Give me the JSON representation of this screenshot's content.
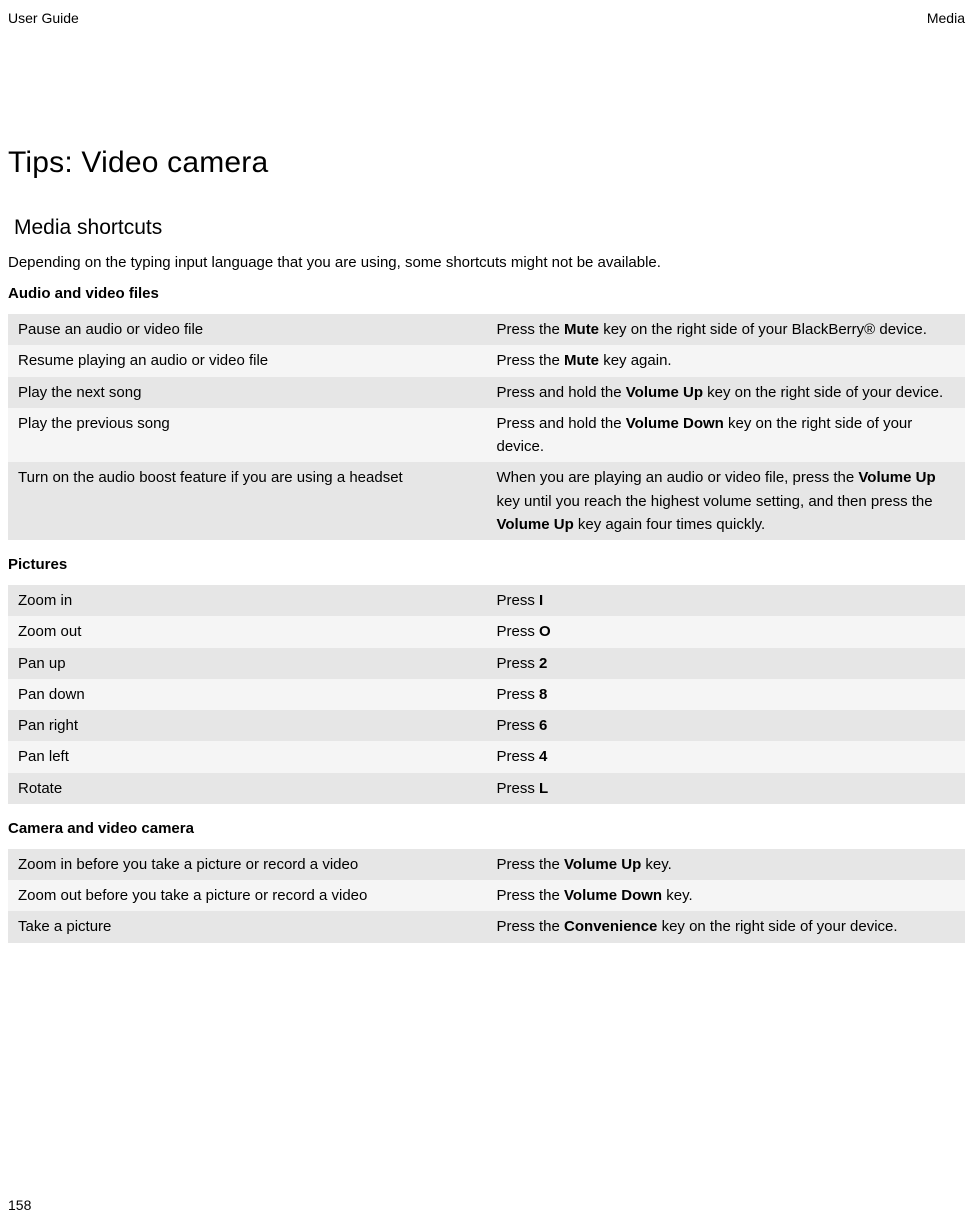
{
  "header": {
    "left": "User Guide",
    "right": "Media"
  },
  "page_number": "158",
  "title": "Tips: Video camera",
  "section_heading": "Media shortcuts",
  "intro": "Depending on the typing input language that you are using, some shortcuts might not be available.",
  "tables": {
    "audio_video": {
      "heading": "Audio and video files",
      "rows": [
        {
          "label": "Pause an audio or video file",
          "parts": [
            "Press the ",
            "Mute",
            " key on the right side of your BlackBerry® device."
          ]
        },
        {
          "label": "Resume playing an audio or video file",
          "parts": [
            "Press the ",
            "Mute",
            " key again."
          ]
        },
        {
          "label": "Play the next song",
          "parts": [
            "Press and hold the ",
            "Volume Up",
            " key on the right side of your device."
          ]
        },
        {
          "label": "Play the previous song",
          "parts": [
            "Press and hold the ",
            "Volume Down",
            " key on the right side of your device."
          ]
        },
        {
          "label": "Turn on the audio boost feature if you are using a headset",
          "parts": [
            "When you are playing an audio or video file, press the ",
            "Volume Up",
            " key until you reach the highest volume setting, and then press the ",
            "Volume Up",
            " key again four times quickly."
          ]
        }
      ]
    },
    "pictures": {
      "heading": "Pictures",
      "rows": [
        {
          "label": "Zoom in",
          "parts": [
            "Press ",
            "I"
          ]
        },
        {
          "label": "Zoom out",
          "parts": [
            "Press ",
            "O"
          ]
        },
        {
          "label": "Pan up",
          "parts": [
            "Press ",
            "2"
          ]
        },
        {
          "label": "Pan down",
          "parts": [
            "Press ",
            "8"
          ]
        },
        {
          "label": "Pan right",
          "parts": [
            "Press ",
            "6"
          ]
        },
        {
          "label": "Pan left",
          "parts": [
            "Press ",
            "4"
          ]
        },
        {
          "label": "Rotate",
          "parts": [
            "Press ",
            "L"
          ]
        }
      ]
    },
    "camera": {
      "heading": "Camera and video camera",
      "rows": [
        {
          "label": "Zoom in before you take a picture or record a video",
          "parts": [
            "Press the ",
            "Volume Up",
            " key."
          ]
        },
        {
          "label": "Zoom out before you take a picture or record a video",
          "parts": [
            "Press the ",
            "Volume Down",
            " key."
          ]
        },
        {
          "label": "Take a picture",
          "parts": [
            "Press the ",
            "Convenience",
            " key on the right side of your device."
          ]
        }
      ]
    }
  }
}
